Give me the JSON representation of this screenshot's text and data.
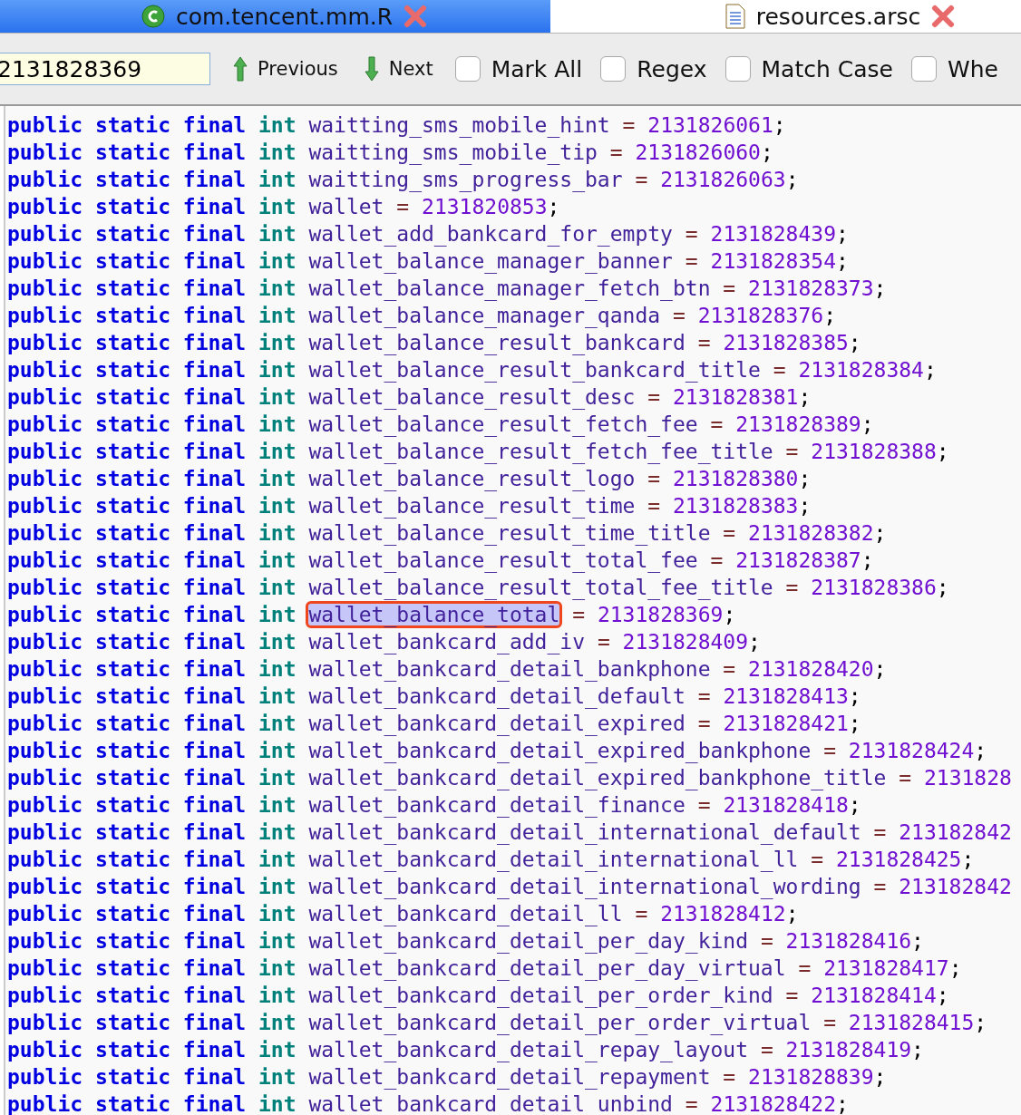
{
  "tabs": [
    {
      "label": "com.tencent.mm.R",
      "selected": true,
      "kind": "class"
    },
    {
      "label": "resources.arsc",
      "selected": false,
      "kind": "file"
    }
  ],
  "find_bar": {
    "search": {
      "value": "2131828369"
    },
    "buttons": [
      {
        "label": "Previous",
        "kind": "up"
      },
      {
        "label": "Next",
        "kind": "down"
      }
    ],
    "options": [
      {
        "label": "Mark All",
        "checked": false
      },
      {
        "label": "Regex",
        "checked": false
      },
      {
        "label": "Match Case",
        "checked": false
      },
      {
        "label": "Whe",
        "checked": false
      }
    ]
  },
  "code": {
    "lines": [
      {
        "modifiers": "public static final",
        "type": "int",
        "name": "waitting_sms_mobile_hint",
        "op": "=",
        "value": "2131826061",
        "end": ";",
        "selected": false
      },
      {
        "modifiers": "public static final",
        "type": "int",
        "name": "waitting_sms_mobile_tip",
        "op": "=",
        "value": "2131826060",
        "end": ";",
        "selected": false
      },
      {
        "modifiers": "public static final",
        "type": "int",
        "name": "waitting_sms_progress_bar",
        "op": "=",
        "value": "2131826063",
        "end": ";",
        "selected": false
      },
      {
        "modifiers": "public static final",
        "type": "int",
        "name": "wallet",
        "op": "=",
        "value": "2131820853",
        "end": ";",
        "selected": false
      },
      {
        "modifiers": "public static final",
        "type": "int",
        "name": "wallet_add_bankcard_for_empty",
        "op": "=",
        "value": "2131828439",
        "end": ";",
        "selected": false
      },
      {
        "modifiers": "public static final",
        "type": "int",
        "name": "wallet_balance_manager_banner",
        "op": "=",
        "value": "2131828354",
        "end": ";",
        "selected": false
      },
      {
        "modifiers": "public static final",
        "type": "int",
        "name": "wallet_balance_manager_fetch_btn",
        "op": "=",
        "value": "2131828373",
        "end": ";",
        "selected": false
      },
      {
        "modifiers": "public static final",
        "type": "int",
        "name": "wallet_balance_manager_qanda",
        "op": "=",
        "value": "2131828376",
        "end": ";",
        "selected": false
      },
      {
        "modifiers": "public static final",
        "type": "int",
        "name": "wallet_balance_result_bankcard",
        "op": "=",
        "value": "2131828385",
        "end": ";",
        "selected": false
      },
      {
        "modifiers": "public static final",
        "type": "int",
        "name": "wallet_balance_result_bankcard_title",
        "op": "=",
        "value": "2131828384",
        "end": ";",
        "selected": false
      },
      {
        "modifiers": "public static final",
        "type": "int",
        "name": "wallet_balance_result_desc",
        "op": "=",
        "value": "2131828381",
        "end": ";",
        "selected": false
      },
      {
        "modifiers": "public static final",
        "type": "int",
        "name": "wallet_balance_result_fetch_fee",
        "op": "=",
        "value": "2131828389",
        "end": ";",
        "selected": false
      },
      {
        "modifiers": "public static final",
        "type": "int",
        "name": "wallet_balance_result_fetch_fee_title",
        "op": "=",
        "value": "2131828388",
        "end": ";",
        "selected": false
      },
      {
        "modifiers": "public static final",
        "type": "int",
        "name": "wallet_balance_result_logo",
        "op": "=",
        "value": "2131828380",
        "end": ";",
        "selected": false
      },
      {
        "modifiers": "public static final",
        "type": "int",
        "name": "wallet_balance_result_time",
        "op": "=",
        "value": "2131828383",
        "end": ";",
        "selected": false
      },
      {
        "modifiers": "public static final",
        "type": "int",
        "name": "wallet_balance_result_time_title",
        "op": "=",
        "value": "2131828382",
        "end": ";",
        "selected": false
      },
      {
        "modifiers": "public static final",
        "type": "int",
        "name": "wallet_balance_result_total_fee",
        "op": "=",
        "value": "2131828387",
        "end": ";",
        "selected": false
      },
      {
        "modifiers": "public static final",
        "type": "int",
        "name": "wallet_balance_result_total_fee_title",
        "op": "=",
        "value": "2131828386",
        "end": ";",
        "selected": false
      },
      {
        "modifiers": "public static final",
        "type": "int",
        "name": "wallet_balance_total",
        "op": "=",
        "value": "2131828369",
        "end": ";",
        "selected": true
      },
      {
        "modifiers": "public static final",
        "type": "int",
        "name": "wallet_bankcard_add_iv",
        "op": "=",
        "value": "2131828409",
        "end": ";",
        "selected": false
      },
      {
        "modifiers": "public static final",
        "type": "int",
        "name": "wallet_bankcard_detail_bankphone",
        "op": "=",
        "value": "2131828420",
        "end": ";",
        "selected": false
      },
      {
        "modifiers": "public static final",
        "type": "int",
        "name": "wallet_bankcard_detail_default",
        "op": "=",
        "value": "2131828413",
        "end": ";",
        "selected": false
      },
      {
        "modifiers": "public static final",
        "type": "int",
        "name": "wallet_bankcard_detail_expired",
        "op": "=",
        "value": "2131828421",
        "end": ";",
        "selected": false
      },
      {
        "modifiers": "public static final",
        "type": "int",
        "name": "wallet_bankcard_detail_expired_bankphone",
        "op": "=",
        "value": "2131828424",
        "end": ";",
        "selected": false
      },
      {
        "modifiers": "public static final",
        "type": "int",
        "name": "wallet_bankcard_detail_expired_bankphone_title",
        "op": "=",
        "value": "2131828",
        "selected": false
      },
      {
        "modifiers": "public static final",
        "type": "int",
        "name": "wallet_bankcard_detail_finance",
        "op": "=",
        "value": "2131828418",
        "end": ";",
        "selected": false
      },
      {
        "modifiers": "public static final",
        "type": "int",
        "name": "wallet_bankcard_detail_international_default",
        "op": "=",
        "value": "213182842",
        "selected": false
      },
      {
        "modifiers": "public static final",
        "type": "int",
        "name": "wallet_bankcard_detail_international_ll",
        "op": "=",
        "value": "2131828425",
        "end": ";",
        "selected": false
      },
      {
        "modifiers": "public static final",
        "type": "int",
        "name": "wallet_bankcard_detail_international_wording",
        "op": "=",
        "value": "213182842",
        "selected": false
      },
      {
        "modifiers": "public static final",
        "type": "int",
        "name": "wallet_bankcard_detail_ll",
        "op": "=",
        "value": "2131828412",
        "end": ";",
        "selected": false
      },
      {
        "modifiers": "public static final",
        "type": "int",
        "name": "wallet_bankcard_detail_per_day_kind",
        "op": "=",
        "value": "2131828416",
        "end": ";",
        "selected": false
      },
      {
        "modifiers": "public static final",
        "type": "int",
        "name": "wallet_bankcard_detail_per_day_virtual",
        "op": "=",
        "value": "2131828417",
        "end": ";",
        "selected": false
      },
      {
        "modifiers": "public static final",
        "type": "int",
        "name": "wallet_bankcard_detail_per_order_kind",
        "op": "=",
        "value": "2131828414",
        "end": ";",
        "selected": false
      },
      {
        "modifiers": "public static final",
        "type": "int",
        "name": "wallet_bankcard_detail_per_order_virtual",
        "op": "=",
        "value": "2131828415",
        "end": ";",
        "selected": false
      },
      {
        "modifiers": "public static final",
        "type": "int",
        "name": "wallet_bankcard_detail_repay_layout",
        "op": "=",
        "value": "2131828419",
        "end": ";",
        "selected": false
      },
      {
        "modifiers": "public static final",
        "type": "int",
        "name": "wallet_bankcard_detail_repayment",
        "op": "=",
        "value": "2131828839",
        "end": ";",
        "selected": false
      },
      {
        "modifiers": "public static final",
        "type": "int",
        "name": "wallet_bankcard_detail_unbind",
        "op": "=",
        "value": "2131828422",
        "end": ";",
        "selected": false
      }
    ]
  }
}
